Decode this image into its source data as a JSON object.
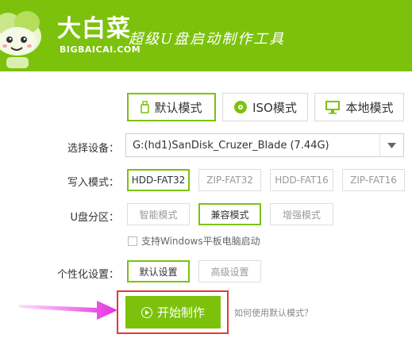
{
  "header": {
    "brand_cn": "大白菜",
    "brand_en": "BIGBAICAI.COM",
    "slogan": "超级U盘启动制作工具"
  },
  "mode_tabs": [
    {
      "label": "默认模式",
      "icon": "usb-drive-icon",
      "active": true
    },
    {
      "label": "ISO模式",
      "icon": "disc-icon",
      "active": false
    },
    {
      "label": "本地模式",
      "icon": "monitor-icon",
      "active": false
    }
  ],
  "device": {
    "label": "选择设备：",
    "value": "G:(hd1)SanDisk_Cruzer_Blade (7.44G)"
  },
  "write_mode": {
    "label": "写入模式：",
    "options": [
      "HDD-FAT32",
      "ZIP-FAT32",
      "HDD-FAT16",
      "ZIP-FAT16"
    ],
    "selected": "HDD-FAT32"
  },
  "partition": {
    "label": "U盘分区：",
    "options": [
      "智能模式",
      "兼容模式",
      "增强模式"
    ],
    "selected": "兼容模式",
    "checkbox_label": "支持Windows平板电脑启动",
    "checkbox_checked": false
  },
  "personalize": {
    "label": "个性化设置：",
    "options": [
      "默认设置",
      "高级设置"
    ],
    "selected": "默认设置"
  },
  "start_button": {
    "label": "开始制作"
  },
  "help_link": "如何使用默认模式？",
  "colors": {
    "brand_green": "#7cc20c",
    "highlight_red": "#e03a3a",
    "arrow_magenta": "#e52fe0"
  }
}
